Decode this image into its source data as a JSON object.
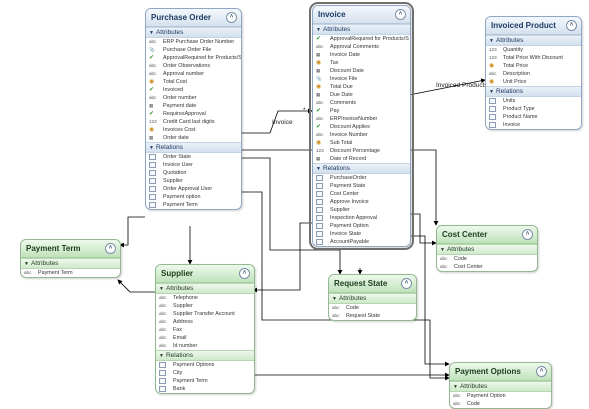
{
  "entities": {
    "purchase_order": {
      "title": "Purchase Order",
      "attributes_label": "Attributes",
      "attributes": [
        {
          "icon": "abc",
          "name": "ERP Purchase Order Number"
        },
        {
          "icon": "clip",
          "name": "Purchase Order File"
        },
        {
          "icon": "check",
          "name": "ApprovalRequired for Products/S"
        },
        {
          "icon": "abc",
          "name": "Order Observations"
        },
        {
          "icon": "abc",
          "name": "Approval number"
        },
        {
          "icon": "money",
          "name": "Total Cost"
        },
        {
          "icon": "check",
          "name": "Invoiced"
        },
        {
          "icon": "abc",
          "name": "Order number"
        },
        {
          "icon": "date",
          "name": "Payment date"
        },
        {
          "icon": "check",
          "name": "RequiresApproval"
        },
        {
          "icon": "123",
          "name": "Credit Card last digits"
        },
        {
          "icon": "money",
          "name": "Invoices Cost"
        },
        {
          "icon": "date",
          "name": "Order date"
        }
      ],
      "relations_label": "Relations",
      "relations": [
        "Order State",
        "Invoice User",
        "Quotation",
        "Supplier",
        "Order Approval User",
        "Payment option",
        "Payment Term"
      ]
    },
    "invoice": {
      "title": "Invoice",
      "attributes_label": "Attributes",
      "attributes": [
        {
          "icon": "check",
          "name": "ApprovalRequired for Products/S"
        },
        {
          "icon": "abc",
          "name": "Approval Comments"
        },
        {
          "icon": "date",
          "name": "Invoice Date"
        },
        {
          "icon": "money",
          "name": "Tax"
        },
        {
          "icon": "date",
          "name": "Discount Date"
        },
        {
          "icon": "clip",
          "name": "Invoice File"
        },
        {
          "icon": "money",
          "name": "Total Due"
        },
        {
          "icon": "date",
          "name": "Due Date"
        },
        {
          "icon": "abc",
          "name": "Comments"
        },
        {
          "icon": "check",
          "name": "Pay"
        },
        {
          "icon": "abc",
          "name": "ERPInvoiceNumber"
        },
        {
          "icon": "check",
          "name": "Discount Applies"
        },
        {
          "icon": "abc",
          "name": "Invoice Number"
        },
        {
          "icon": "money",
          "name": "Sub Total"
        },
        {
          "icon": "123",
          "name": "Discount Percentage"
        },
        {
          "icon": "date",
          "name": "Date of Record"
        }
      ],
      "relations_label": "Relations",
      "relations": [
        "PurchaseOrder",
        "Payment State",
        "Cost Center",
        "Approve Invoice",
        "Supplier",
        "Inspection Approval",
        "Payment Option",
        "Invoice State",
        "AccountPayable"
      ]
    },
    "invoiced_product": {
      "title": "Invoiced Product",
      "attributes_label": "Attributes",
      "attributes": [
        {
          "icon": "123",
          "name": "Quantity"
        },
        {
          "icon": "123",
          "name": "Total Price With Discount"
        },
        {
          "icon": "money",
          "name": "Total Price"
        },
        {
          "icon": "abc",
          "name": "Description"
        },
        {
          "icon": "money",
          "name": "Unit Price"
        }
      ],
      "relations_label": "Relations",
      "relations": [
        "Units",
        "Product Type",
        "Product Name",
        "Invoice"
      ]
    },
    "payment_term": {
      "title": "Payment Term",
      "attributes_label": "Attributes",
      "attributes": [
        {
          "icon": "abc",
          "name": "Payment Term"
        }
      ],
      "relations_label": "",
      "relations": []
    },
    "supplier": {
      "title": "Supplier",
      "attributes_label": "Attributes",
      "attributes": [
        {
          "icon": "abc",
          "name": "Telephone"
        },
        {
          "icon": "abc",
          "name": "Supplier"
        },
        {
          "icon": "abc",
          "name": "Supplier Transfer Account"
        },
        {
          "icon": "abc",
          "name": "Address"
        },
        {
          "icon": "abc",
          "name": "Fax"
        },
        {
          "icon": "abc",
          "name": "Email"
        },
        {
          "icon": "abc",
          "name": "Id number"
        }
      ],
      "relations_label": "Relations",
      "relations": [
        "Payment Options",
        "City",
        "Payment Term",
        "Bank"
      ]
    },
    "request_state": {
      "title": "Request State",
      "attributes_label": "Attributes",
      "attributes": [
        {
          "icon": "abc",
          "name": "Code"
        },
        {
          "icon": "abc",
          "name": "Request State"
        }
      ],
      "relations_label": "",
      "relations": []
    },
    "cost_center": {
      "title": "Cost Center",
      "attributes_label": "Attributes",
      "attributes": [
        {
          "icon": "abc",
          "name": "Code"
        },
        {
          "icon": "abc",
          "name": "Cost Center"
        }
      ],
      "relations_label": "",
      "relations": []
    },
    "payment_options": {
      "title": "Payment Options",
      "attributes_label": "Attributes",
      "attributes": [
        {
          "icon": "abc",
          "name": "Payment Option"
        },
        {
          "icon": "abc",
          "name": "Code"
        }
      ],
      "relations_label": "",
      "relations": []
    }
  },
  "edge_labels": {
    "invoice": "Invoice",
    "invoice_mult": "*",
    "invoiced_products": "Invoiced Products"
  },
  "colors": {
    "connector": "#000000",
    "blue_header": "#d5e1ee",
    "green_header": "#bfe2bb"
  }
}
